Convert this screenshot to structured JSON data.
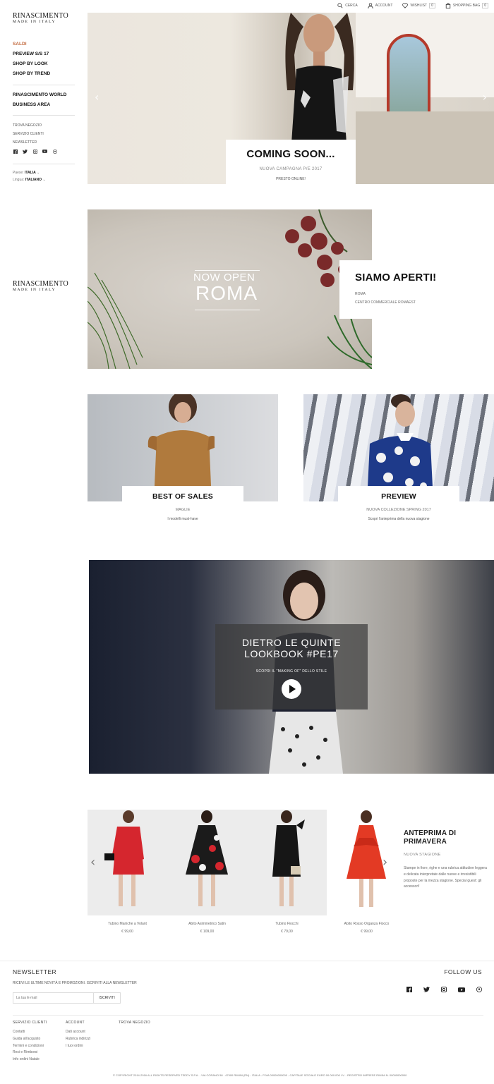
{
  "brand": {
    "name": "RINASCIMENTO",
    "tagline": "MADE IN ITALY"
  },
  "topbar": [
    {
      "label": "CERCA",
      "icon": "search-icon"
    },
    {
      "label": "ACCOUNT",
      "icon": "user-icon"
    },
    {
      "label": "WISHLIST",
      "icon": "heart-icon",
      "count": "0"
    },
    {
      "label": "SHOPPING BAG",
      "icon": "bag-icon",
      "count": "0"
    }
  ],
  "sidebar": {
    "main_items": [
      "SALDI",
      "PREVIEW S/S 17",
      "SHOP BY LOOK",
      "SHOP BY TREND"
    ],
    "secondary_items": [
      "RINASCIMENTO WORLD",
      "BUSINESS AREA"
    ],
    "small_items": [
      "TROVA NEGOZIO",
      "SERVIZIO CLIENTI",
      "NEWSLETTER"
    ],
    "social": [
      "facebook-icon",
      "twitter-icon",
      "instagram-icon",
      "youtube-icon",
      "pinterest-icon"
    ],
    "country_label": "Paese:",
    "country_value": "ITALIA",
    "language_label": "Lingua:",
    "language_value": "ITALIANO"
  },
  "hero": {
    "title": "COMING SOON...",
    "subtitle": "NUOVA CAMPAGNA P/E 2017",
    "note": "PRESTO ONLINE!",
    "prev_arrow": "‹",
    "next_arrow": "›"
  },
  "roma": {
    "banner_top": "NOW OPEN",
    "banner_city": "ROMA",
    "card_title": "SIAMO APERTI!",
    "card_city": "ROMA",
    "card_place": "CENTRO COMMERCIALE ROMAEST"
  },
  "tiles": [
    {
      "title": "BEST OF SALES",
      "category": "MAGLIE",
      "desc": "I modelli must-have"
    },
    {
      "title": "PREVIEW",
      "category": "NUOVA COLLEZIONE SPRING 2017",
      "desc": "Scopri l'anteprima della nuova stagione"
    }
  ],
  "video": {
    "line1": "DIETRO LE QUINTE",
    "line2": "LOOKBOOK #PE17",
    "sub": "SCOPRI IL \"MAKING OF\" DELLO STILE"
  },
  "products": [
    {
      "name": "Tubino Maniche a Volant",
      "price": "€ 99,00",
      "color": "#d5262e"
    },
    {
      "name": "Abito Asimmetrico Satin",
      "price": "€ 109,00",
      "color": "#1b1b1b"
    },
    {
      "name": "Tubino Fiocchi",
      "price": "€ 79,00",
      "color": "#161616"
    },
    {
      "name": "Abito Rosso Organza Fiocco",
      "price": "€ 99,00",
      "color": "#e33a24"
    }
  ],
  "products_arrows": {
    "prev": "‹",
    "next": "›"
  },
  "preview_promo": {
    "title_line1": "ANTEPRIMA DI",
    "title_line2": "PRIMAVERA",
    "label": "NUOVA STAGIONE",
    "text": "Stampe in fiore, righe e una rubrica attitudine leggera e delicata interpretate dalle nuove e irresistibili proposte per la mezza stagione. Special guest: gli accessori!"
  },
  "newsletter": {
    "title": "NEWSLETTER",
    "text": "RICEVI LE ULTIME NOVITÀ E PROMOZIONI. ISCRIVITI ALLA NEWSLETTER",
    "placeholder": "La tua E-mail",
    "button": "ISCRIVITI"
  },
  "follow": {
    "title": "FOLLOW US",
    "icons": [
      "facebook-icon",
      "twitter-icon",
      "instagram-icon",
      "youtube-icon",
      "pinterest-icon"
    ]
  },
  "footer_cols": [
    {
      "title": "SERVIZIO CLIENTI",
      "links": [
        "Contatti",
        "Guida all'acquisto",
        "Termini e condizioni",
        "Resi e Rimborsi",
        "Info ordini Natale"
      ]
    },
    {
      "title": "ACCOUNT",
      "links": [
        "Dati account",
        "Rubrica indirizzi",
        "I tuoi ordini"
      ]
    },
    {
      "title": "TROVA NEGOZIO",
      "links": []
    }
  ],
  "copyright": "© COPYRIGHT 2014-2016 ALL RIGHTS RESERVED TEDDY S.P.A. - VIA CORANO 58 - 47900 RIMINI (RN) - ITALIA - P.IVA 00000000000 - CAPITALE SOCIALE EURO 00.000.000 I.V. - REGISTRO IMPRESE RIMINI N. 00000000000",
  "colors": {
    "accent": "#c2693d",
    "text": "#111111",
    "muted": "#888888"
  }
}
